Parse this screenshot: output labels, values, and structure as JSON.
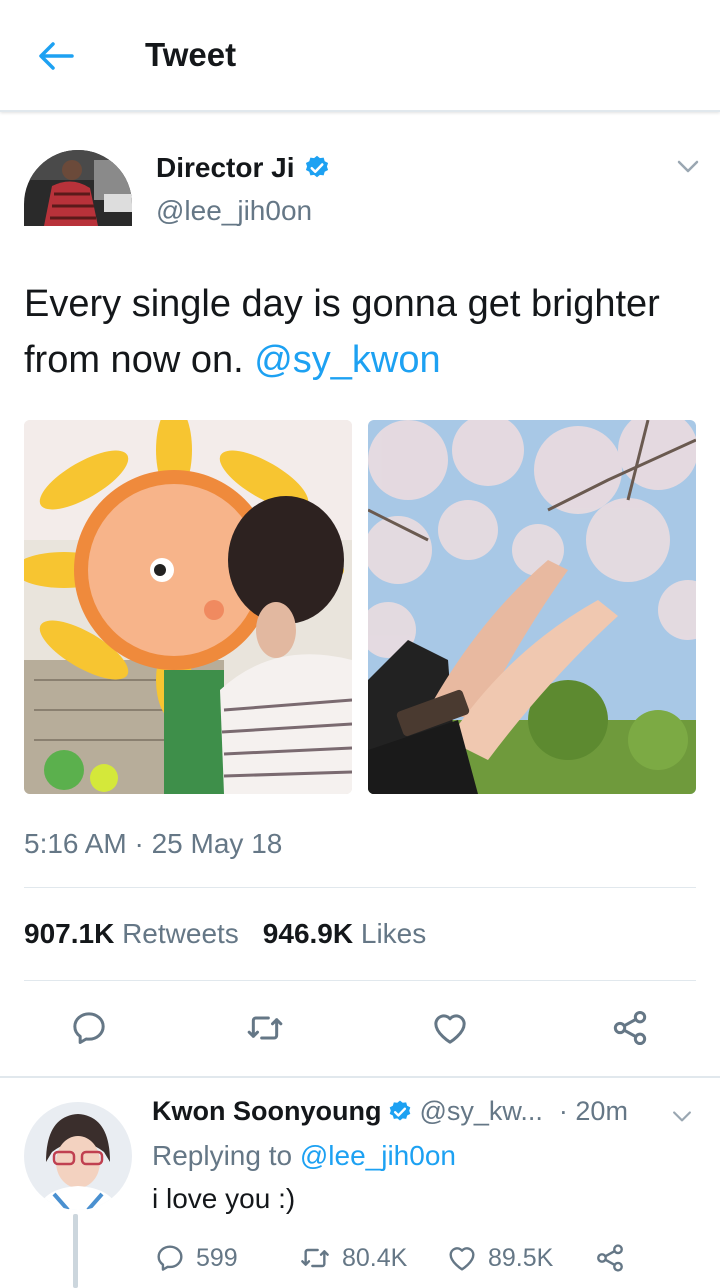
{
  "header": {
    "title": "Tweet"
  },
  "tweet": {
    "author_name": "Director Ji",
    "author_handle": "@lee_jih0on",
    "text": "Every single day is gonna get brighter from now on. ",
    "mention": "@sy_kwon",
    "timestamp": "5:16 AM · 25 May 18",
    "retweets_count": "907.1K",
    "retweets_label": "Retweets",
    "likes_count": "946.9K",
    "likes_label": "Likes"
  },
  "reply": {
    "author_name": "Kwon Soonyoung",
    "author_handle": "@sy_kw...",
    "time": "· 20m",
    "replying_prefix": "Replying to ",
    "replying_to": "@lee_jih0on",
    "text": "i love you :)",
    "reply_count": "599",
    "retweet_count": "80.4K",
    "like_count": "89.5K"
  },
  "colors": {
    "accent": "#1da1f2",
    "secondary_text": "#657786",
    "divider": "#e1e8ed",
    "icon": "#657786"
  },
  "icons": [
    "back-arrow-icon",
    "verified-badge-icon",
    "chevron-down-icon",
    "reply-icon",
    "retweet-icon",
    "like-icon",
    "share-icon"
  ]
}
